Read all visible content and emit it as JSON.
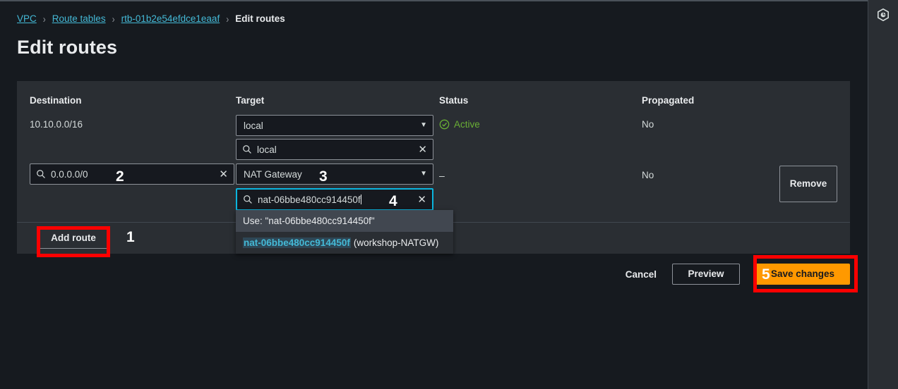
{
  "breadcrumb": {
    "items": [
      {
        "label": "VPC",
        "type": "link"
      },
      {
        "label": "Route tables",
        "type": "link"
      },
      {
        "label": "rtb-01b2e54efdce1eaaf",
        "type": "link"
      },
      {
        "label": "Edit routes",
        "type": "current"
      }
    ],
    "separator": "›"
  },
  "page": {
    "title": "Edit routes"
  },
  "rail": {
    "icon": "aws-cloudshell-hexagon-icon"
  },
  "table": {
    "headers": {
      "destination": "Destination",
      "target": "Target",
      "status": "Status",
      "propagated": "Propagated"
    },
    "rows": [
      {
        "destination_text": "10.10.0.0/16",
        "target_select_value": "local",
        "target_search_value": "local",
        "status": "Active",
        "status_icon": "check-circle-icon",
        "propagated": "No"
      },
      {
        "destination_search_value": "0.0.0.0/0",
        "target_select_value": "NAT Gateway",
        "target_search_value": "nat-06bbe480cc914450f",
        "status": "–",
        "propagated": "No",
        "remove_label": "Remove"
      }
    ]
  },
  "suggestions": {
    "items": [
      {
        "kind": "use",
        "label": "Use: \"nat-06bbe480cc914450f\"",
        "highlighted": true
      },
      {
        "kind": "resource",
        "id": "nat-06bbe480cc914450f",
        "name": "(workshop-NATGW)",
        "highlighted": false
      }
    ]
  },
  "buttons": {
    "add_route": "Add route",
    "cancel": "Cancel",
    "preview": "Preview",
    "save_changes": "Save changes"
  },
  "icons": {
    "search": "search-icon",
    "clear": "clear-x-icon",
    "caret": "▼"
  },
  "annotations": {
    "step1": "1",
    "step2": "2",
    "step3": "3",
    "step4": "4",
    "step5": "5"
  },
  "colors": {
    "accent_orange": "#ff9900",
    "link_cyan": "#44b9d6",
    "status_green": "#6aaf35",
    "focus_cyan": "#0bb5de",
    "annotation_red": "#fe0000",
    "panel_bg": "#2a2e33",
    "page_bg": "#161a1f"
  }
}
